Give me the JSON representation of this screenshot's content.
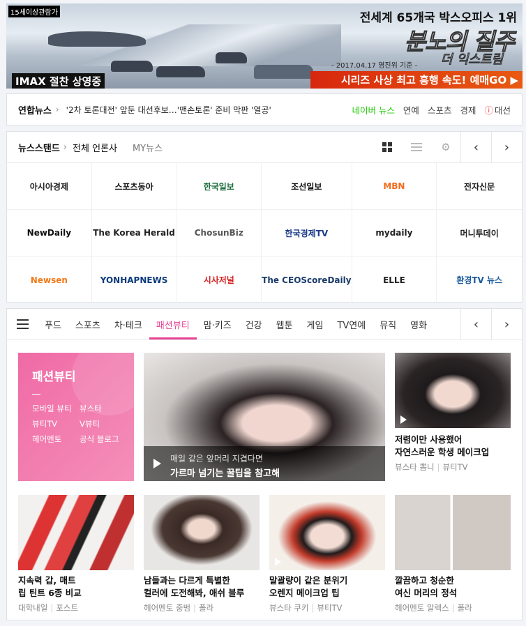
{
  "banner": {
    "age": "15세이상관람가",
    "imax": "IMAX 절찬 상영중",
    "line1": "전세계 65개국 박스오피스 1위",
    "title": "분노의 질주",
    "subtitle": "더 익스트림",
    "rank_note": "- 2017.04.17 영진위 기준 -",
    "cta": "시리즈 사상 최고 흥행 속도! 예매GO ▶"
  },
  "news_bar": {
    "source": "연합뉴스",
    "headline": "'2차 토론대전' 앞둔 대선후보…'맨손토론' 준비 막판 '열공'",
    "tabs": [
      "네이버 뉴스",
      "연예",
      "스포츠",
      "경제",
      "대선"
    ]
  },
  "newsstand": {
    "title": "뉴스스탠드",
    "all": "전체 언론사",
    "my": "MY뉴스",
    "press": [
      {
        "name": "아시아경제",
        "color": "#222222"
      },
      {
        "name": "스포츠동아",
        "color": "#111111"
      },
      {
        "name": "한국일보",
        "color": "#1a6b3a"
      },
      {
        "name": "조선일보",
        "color": "#111111"
      },
      {
        "name": "MBN",
        "color": "#f26b1d"
      },
      {
        "name": "전자신문",
        "color": "#222222"
      },
      {
        "name": "NewDaily",
        "color": "#111111"
      },
      {
        "name": "The Korea Herald",
        "color": "#222222"
      },
      {
        "name": "ChosunBiz",
        "color": "#555555"
      },
      {
        "name": "한국경제TV",
        "color": "#1a3a8a"
      },
      {
        "name": "mydaily",
        "color": "#222222"
      },
      {
        "name": "머니투데이",
        "color": "#222222"
      },
      {
        "name": "Newsen",
        "color": "#f27a1a"
      },
      {
        "name": "YONHAPNEWS",
        "color": "#0a3a7a"
      },
      {
        "name": "시사저널",
        "color": "#d42020"
      },
      {
        "name": "The CEOScoreDaily",
        "color": "#1a3a6a"
      },
      {
        "name": "ELLE",
        "color": "#222222"
      },
      {
        "name": "환경TV 뉴스",
        "color": "#1a5a9a"
      }
    ]
  },
  "categories": {
    "tabs": [
      "푸드",
      "스포츠",
      "차·테크",
      "패션뷰티",
      "맘·키즈",
      "건강",
      "웹툰",
      "게임",
      "TV연예",
      "뮤직",
      "영화"
    ],
    "active": "패션뷰티"
  },
  "beauty": {
    "card_title": "패션뷰티",
    "links": [
      "모바일 뷰티",
      "뷰스타",
      "뷰티TV",
      "V뷰티",
      "헤어멘토",
      "공식 블로그"
    ],
    "feature": {
      "line1": "매일 같은 앞머리 지겹다면",
      "line2": "가르마 넘기는 꿀팁을 참고해"
    },
    "items": [
      {
        "title1": "저렴이만 사용했어",
        "title2": "자연스러운 학생 메이크업",
        "meta": [
          "뷰스타 뽐니",
          "뷰티TV"
        ]
      },
      {
        "title1": "지속력 갑, 매트",
        "title2": "립 틴트 6종 비교",
        "meta": [
          "대학내일",
          "포스트"
        ]
      },
      {
        "title1": "남들과는 다르게 특별한",
        "title2": "컬러에 도전해봐, 애쉬 블루",
        "meta": [
          "헤어멘토 중범",
          "폴라"
        ]
      },
      {
        "title1": "말괄량이 같은 분위기",
        "title2": "오렌지 메이크업 팁",
        "meta": [
          "뷰스타 쿠키",
          "뷰티TV"
        ]
      },
      {
        "title1": "깔끔하고 청순한",
        "title2": "여신 머리의 정석",
        "meta": [
          "헤어멘토 알렉스",
          "폴라"
        ]
      }
    ]
  }
}
